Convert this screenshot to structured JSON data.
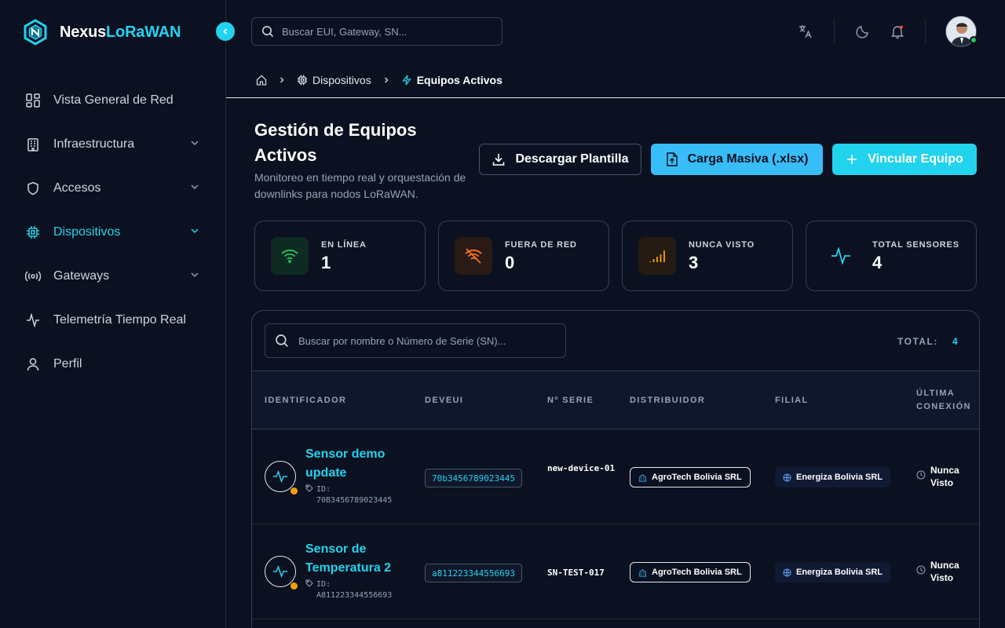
{
  "brand": {
    "name_part1": "Nexus",
    "name_part2": "LoRaWAN"
  },
  "sidebar": {
    "items": [
      {
        "label": "Vista General de Red",
        "icon": "grid-icon",
        "has_chevron": false,
        "active": false
      },
      {
        "label": "Infraestructura",
        "icon": "building-icon",
        "has_chevron": true,
        "active": false
      },
      {
        "label": "Accesos",
        "icon": "shield-icon",
        "has_chevron": true,
        "active": false
      },
      {
        "label": "Dispositivos",
        "icon": "chip-icon",
        "has_chevron": true,
        "active": true
      },
      {
        "label": "Gateways",
        "icon": "broadcast-icon",
        "has_chevron": true,
        "active": false
      },
      {
        "label": "Telemetría Tiempo Real",
        "icon": "activity-icon",
        "has_chevron": false,
        "active": false
      },
      {
        "label": "Perfil",
        "icon": "user-icon",
        "has_chevron": false,
        "active": false
      }
    ]
  },
  "topbar": {
    "search_placeholder": "Buscar EUI, Gateway, SN..."
  },
  "breadcrumb": {
    "level1": "Dispositivos",
    "level2": "Equipos Activos"
  },
  "header": {
    "title": "Gestión de Equipos Activos",
    "subtitle": "Monitoreo en tiempo real y orquestación de downlinks para nodos LoRaWAN.",
    "btn_download": "Descargar Plantilla",
    "btn_bulk": "Carga Masiva (.xlsx)",
    "btn_link": "Vincular Equipo"
  },
  "stats": [
    {
      "label": "EN LÍNEA",
      "value": "1",
      "icon": "wifi-icon",
      "color": "#22c55e"
    },
    {
      "label": "FUERA DE RED",
      "value": "0",
      "icon": "wifi-off-icon",
      "color": "#f97316"
    },
    {
      "label": "NUNCA VISTO",
      "value": "3",
      "icon": "signal-bars-icon",
      "color": "#f59e0b"
    },
    {
      "label": "TOTAL SENSORES",
      "value": "4",
      "icon": "activity-icon",
      "color": "#22d3ee"
    }
  ],
  "table": {
    "search_placeholder": "Buscar por nombre o Número de Serie (SN)...",
    "total_label": "TOTAL:",
    "total_value": "4",
    "headers": [
      "IDENTIFICADOR",
      "DEVEUI",
      "Nº SERIE",
      "DISTRIBUIDOR",
      "FILIAL",
      "ÚLTIMA CONEXIÓN"
    ],
    "rows": [
      {
        "name": "Sensor demo update",
        "id_label": "ID:",
        "id_value": "70B3456789023445",
        "deveui": "70b3456789023445",
        "serial": "new-device-01",
        "distributor": "AgroTech Bolivia SRL",
        "branch": "Energiza Bolivia SRL",
        "last_connection": "Nunca Visto"
      },
      {
        "name": "Sensor de Temperatura 2",
        "id_label": "ID:",
        "id_value": "A811223344556693",
        "deveui": "a811223344556693",
        "serial": "SN-TEST-017",
        "distributor": "AgroTech Bolivia SRL",
        "branch": "Energiza Bolivia SRL",
        "last_connection": "Nunca Visto"
      }
    ]
  },
  "colors": {
    "accent": "#22d3ee",
    "sky": "#38bdf8",
    "background": "#0b1120",
    "online": "#22c55e",
    "warning": "#f59e0b"
  }
}
